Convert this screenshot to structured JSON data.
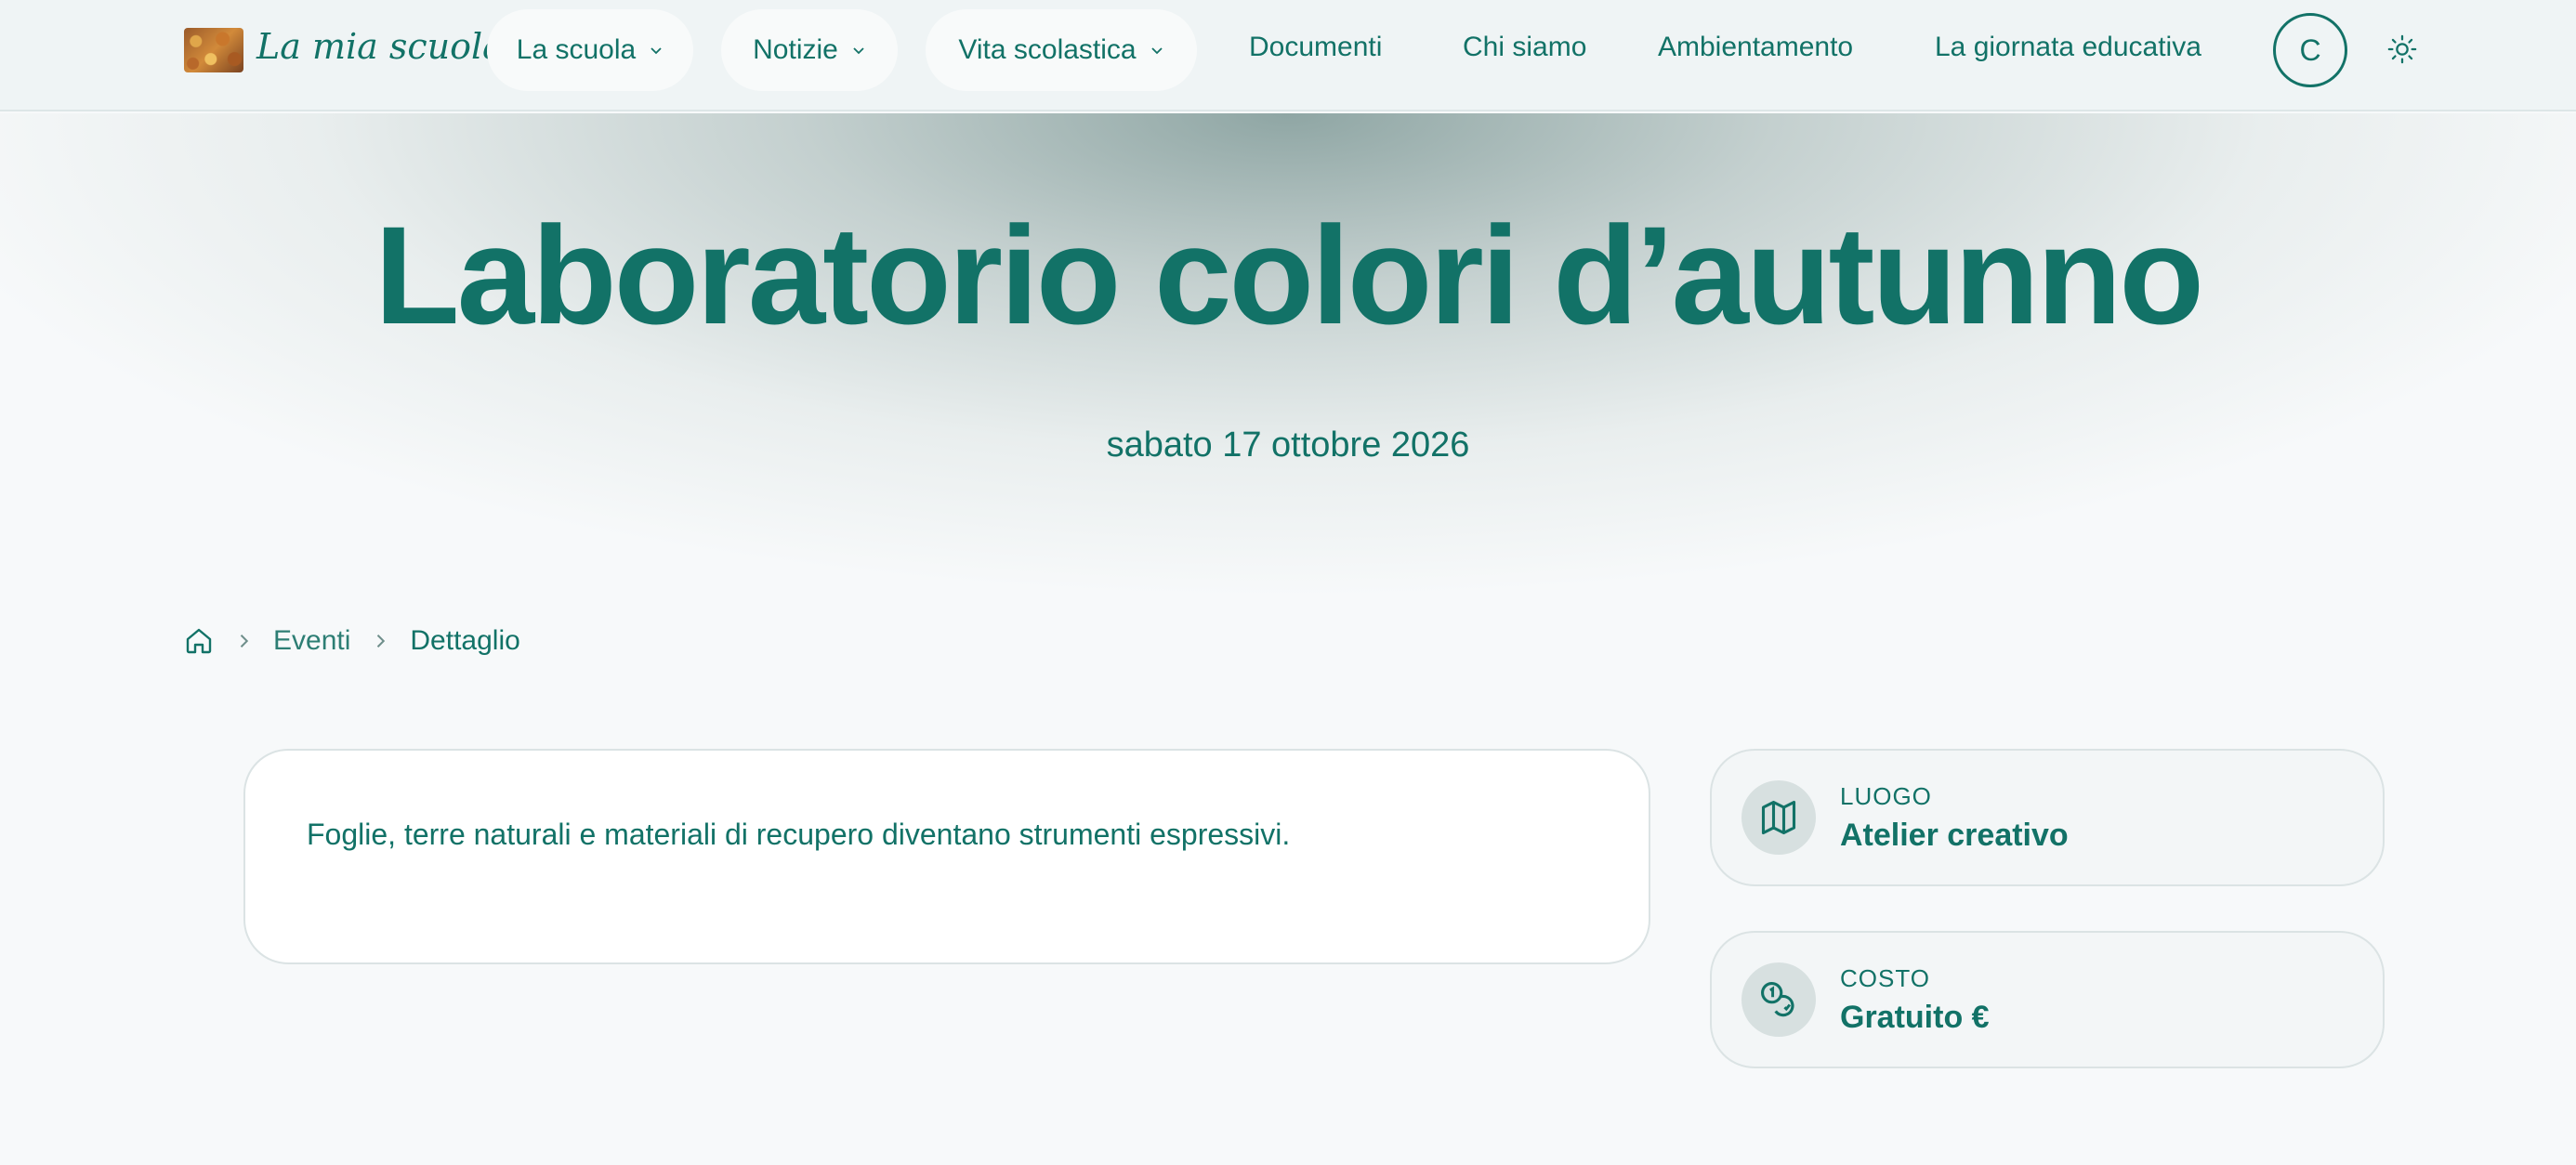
{
  "site": {
    "logo_text": "La mia scuola"
  },
  "nav": {
    "items": [
      {
        "label": "La scuola",
        "dropdown": true
      },
      {
        "label": "Notizie",
        "dropdown": true
      },
      {
        "label": "Vita scolastica",
        "dropdown": true
      },
      {
        "label": "Documenti",
        "dropdown": false
      },
      {
        "label": "Chi siamo",
        "dropdown": false
      },
      {
        "label": "Ambientamento",
        "dropdown": false
      },
      {
        "label": "La giornata educativa",
        "dropdown": false
      }
    ],
    "avatar_initial": "C",
    "theme_icon": "sun-icon"
  },
  "hero": {
    "title": "Laboratorio colori d’autunno",
    "date": "sabato 17 ottobre 2026"
  },
  "breadcrumb": {
    "home_icon": "home-icon",
    "items": [
      "Eventi",
      "Dettaglio"
    ]
  },
  "event": {
    "description": "Foglie, terre naturali e materiali di recupero diventano strumenti espressivi.",
    "details": [
      {
        "label": "LUOGO",
        "value": "Atelier creativo",
        "icon": "map-icon"
      },
      {
        "label": "COSTO",
        "value": "Gratuito €",
        "icon": "coins-icon"
      }
    ]
  },
  "colors": {
    "primary": "#127267",
    "background": "#f7f9fa",
    "nav_bg": "#eff4f5",
    "card_bg": "#ffffff"
  }
}
